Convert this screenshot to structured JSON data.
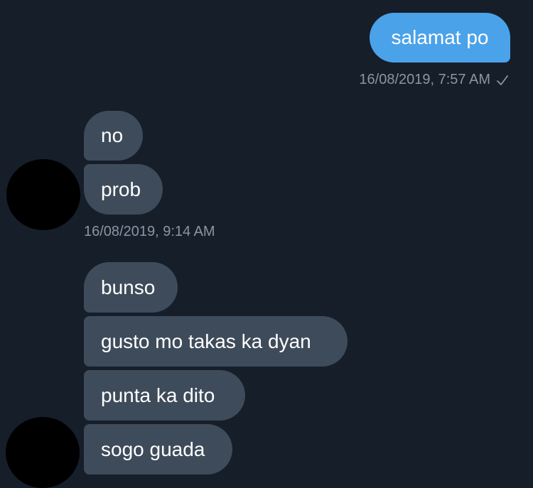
{
  "conversation": {
    "outgoing": {
      "message": "salamat po",
      "timestamp": "16/08/2019, 7:57 AM",
      "status_icon": "check-icon"
    },
    "group1": {
      "messages": [
        "no",
        "prob"
      ],
      "timestamp": "16/08/2019, 9:14 AM"
    },
    "group2": {
      "messages": [
        "bunso",
        "gusto mo takas ka dyan",
        "punta ka dito",
        "sogo guada"
      ]
    }
  },
  "colors": {
    "background": "#161e2a",
    "outgoing_bubble": "#4aa2e9",
    "incoming_bubble": "#3e4b5a",
    "timestamp_text": "#8a96a3"
  }
}
